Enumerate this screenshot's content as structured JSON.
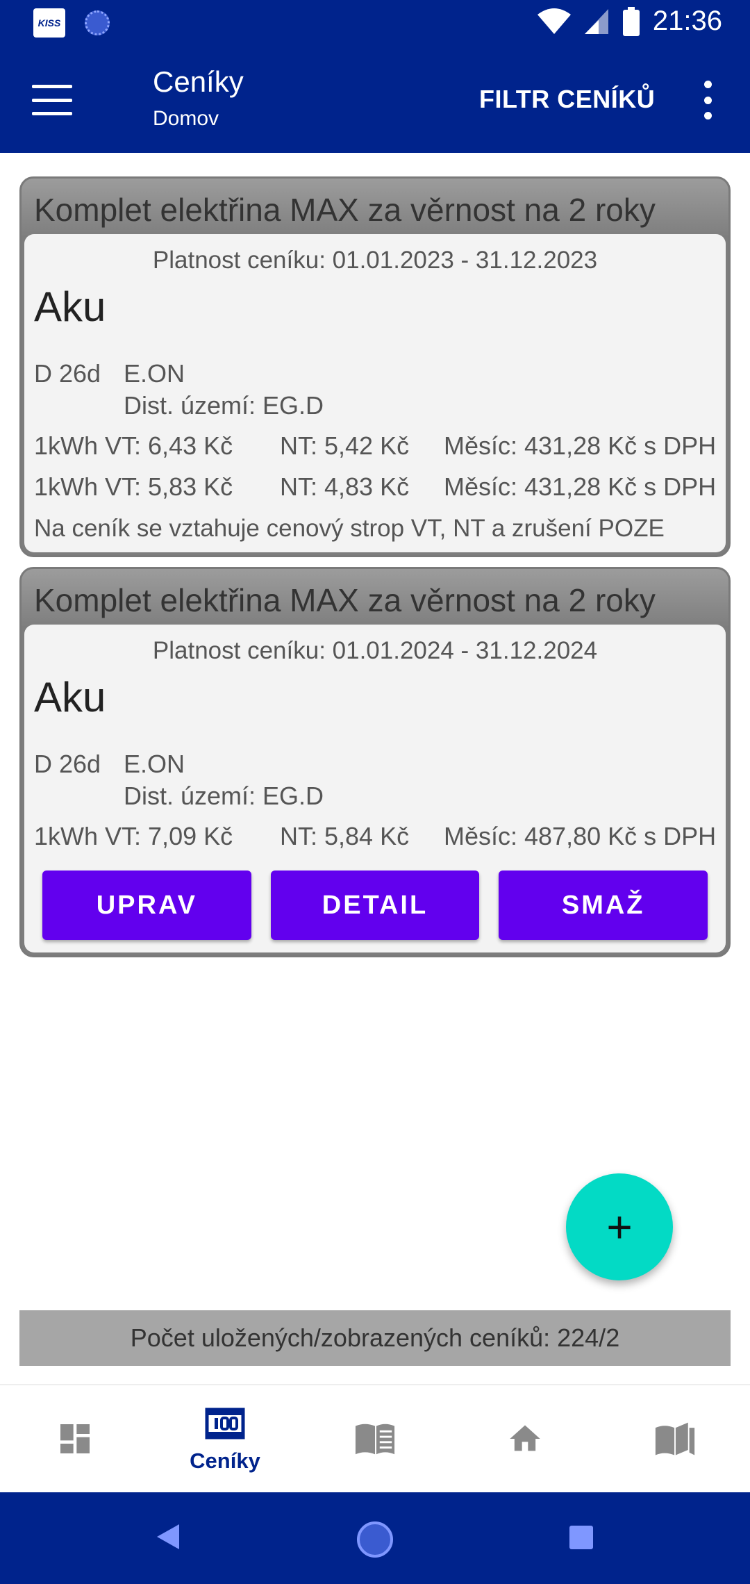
{
  "status_bar": {
    "app_logo": "KISS",
    "time": "21:36",
    "icons": [
      "kiss-app-icon",
      "loading-icon",
      "wifi-icon",
      "signal-icon",
      "battery-icon"
    ]
  },
  "app_bar": {
    "title": "Ceníky",
    "subtitle": "Domov",
    "filter_label": "FILTR CENÍKŮ",
    "icons": [
      "menu-icon",
      "more-vert-icon"
    ]
  },
  "cards": [
    {
      "header": "Komplet elektřina MAX za věrnost na 2 roky",
      "validity": "Platnost ceníku: 01.01.2023 - 31.12.2023",
      "tariff": "Aku",
      "rate_code": "D 26d",
      "distributor": "E.ON",
      "dist_area": "Dist. území: EG.D",
      "prices": [
        {
          "vt": "1kWh VT: 6,43 Kč",
          "nt": "NT: 5,42 Kč",
          "month": "Měsíc: 431,28 Kč s DPH"
        },
        {
          "vt": "1kWh VT: 5,83 Kč",
          "nt": "NT: 4,83 Kč",
          "month": "Měsíc: 431,28 Kč s DPH"
        }
      ],
      "note": "Na ceník se vztahuje cenový strop VT, NT a zrušení POZE"
    },
    {
      "header": "Komplet elektřina MAX za věrnost na 2 roky",
      "validity": "Platnost ceníku: 01.01.2024 - 31.12.2024",
      "tariff": "Aku",
      "rate_code": "D 26d",
      "distributor": "E.ON",
      "dist_area": "Dist. území: EG.D",
      "prices": [
        {
          "vt": "1kWh VT: 7,09 Kč",
          "nt": "NT: 5,84 Kč",
          "month": "Měsíc: 487,80 Kč s DPH"
        }
      ],
      "actions": {
        "edit": "UPRAV",
        "detail": "DETAIL",
        "delete": "SMAŽ"
      }
    }
  ],
  "fab": {
    "label": "+"
  },
  "count_text": "Počet uložených/zobrazených ceníků: 224/2",
  "bottom_nav": {
    "items": [
      {
        "icon": "dashboard-icon",
        "label": ""
      },
      {
        "icon": "price-list-icon",
        "label": "Ceníky",
        "active": true
      },
      {
        "icon": "book-icon",
        "label": ""
      },
      {
        "icon": "home-icon",
        "label": ""
      },
      {
        "icon": "map-book-icon",
        "label": ""
      }
    ]
  },
  "colors": {
    "primary": "#00238c",
    "button": "#6200ee",
    "fab": "#03dac5",
    "card_header": "#7d7d7d",
    "count_bar": "#a6a6a6"
  }
}
